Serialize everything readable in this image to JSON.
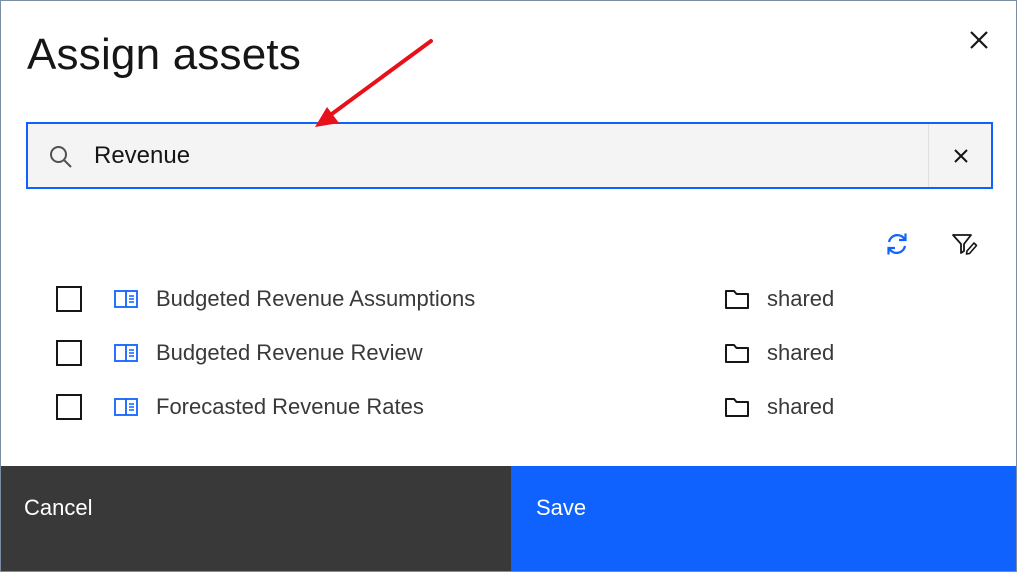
{
  "dialog": {
    "title": "Assign assets",
    "close_icon": "close-icon"
  },
  "search": {
    "value": "Revenue",
    "icon": "search-icon",
    "clear_icon": "close-icon"
  },
  "toolbar": {
    "refresh_icon": "refresh-icon",
    "filter_icon": "filter-edit-icon"
  },
  "assets": [
    {
      "name": "Budgeted Revenue Assumptions",
      "location": "shared",
      "checked": false,
      "icon": "book-icon",
      "location_icon": "folder-icon"
    },
    {
      "name": "Budgeted Revenue Review",
      "location": "shared",
      "checked": false,
      "icon": "book-icon",
      "location_icon": "folder-icon"
    },
    {
      "name": "Forecasted Revenue Rates",
      "location": "shared",
      "checked": false,
      "icon": "book-icon",
      "location_icon": "folder-icon"
    }
  ],
  "footer": {
    "cancel_label": "Cancel",
    "save_label": "Save"
  },
  "colors": {
    "primary": "#0f62fe",
    "secondary": "#393939",
    "field_bg": "#f4f4f4",
    "annotation_arrow": "#e8101a"
  }
}
